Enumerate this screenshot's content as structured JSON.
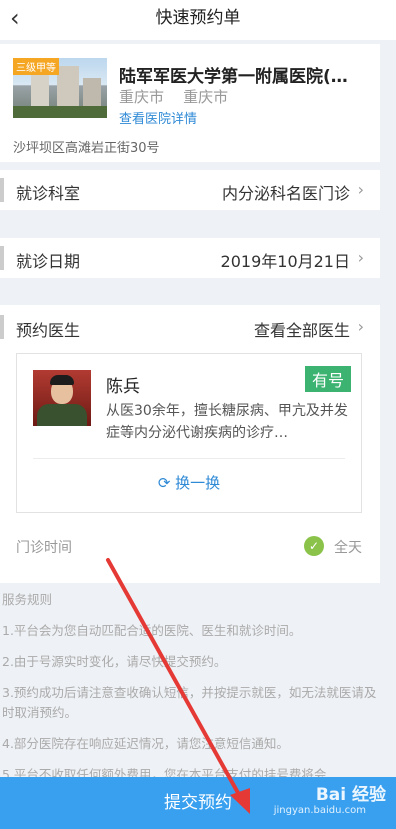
{
  "header": {
    "back_icon": "chevron-left-icon",
    "title": "快速预约单"
  },
  "hospital": {
    "level": "三级甲等",
    "name": "陆军军医大学第一附属医院(…",
    "city": "重庆市    重庆市",
    "detail_link": "查看医院详情",
    "address": "沙坪坝区高滩岩正街30号"
  },
  "department": {
    "label": "就诊科室",
    "value": "内分泌科名医门诊"
  },
  "date": {
    "label": "就诊日期",
    "value": "2019年10月21日"
  },
  "doctor_section": {
    "label": "预约医生",
    "view_all": "查看全部医生",
    "doctor": {
      "name": "陈兵",
      "badge": "有号",
      "description": "从医30余年，擅长糖尿病、甲亢及并发症等内分泌代谢疾病的诊疗…",
      "swap": "换一换"
    },
    "clinic_time_label": "门诊时间",
    "clinic_time_value": "全天"
  },
  "rules": {
    "title": "服务规则",
    "items": [
      "1.平台会为您自动匹配合适的医院、医生和就诊时间。",
      "2.由于号源实时变化，请尽快提交预约。",
      "3.预约成功后请注意查收确认短信，并按提示就医，如无法就医请及时取消预约。",
      "4.部分医院存在响应延迟情况，请您注意短信通知。",
      "5.平台不收取任何额外费用，您在本平台支付的挂号费将会"
    ]
  },
  "submit_label": "提交预约",
  "watermark": {
    "text": "Bai 经验",
    "sub": "jingyan.baidu.com"
  },
  "colors": {
    "accent": "#39a0f0",
    "link": "#2f8ad6",
    "available": "#3cb371",
    "arrow": "#e53935"
  }
}
